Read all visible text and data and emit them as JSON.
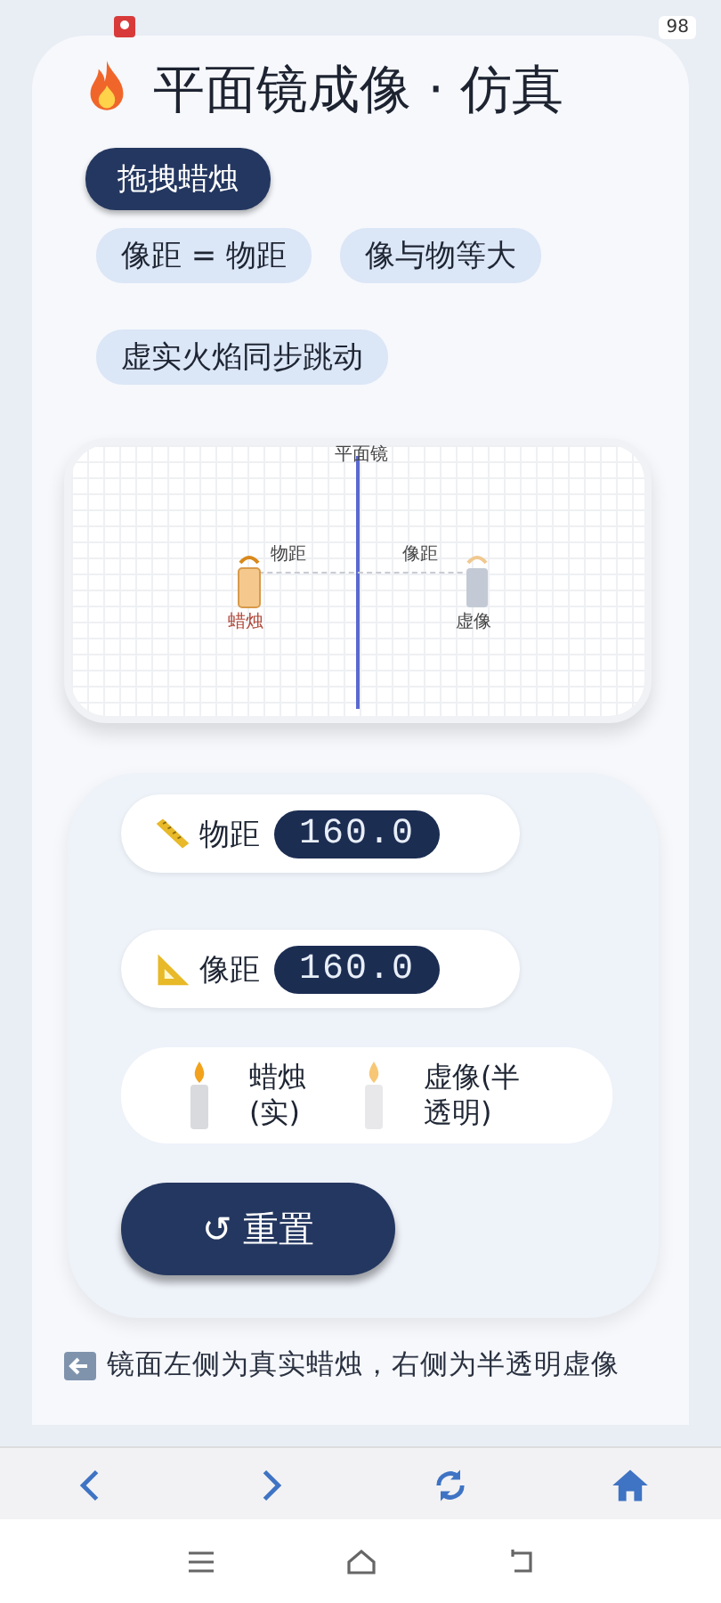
{
  "status_bar": {
    "battery": "98"
  },
  "title": "平面镜成像 · 仿真",
  "drag_button": {
    "label": "拖拽蜡烛"
  },
  "tags": [
    {
      "label": "像距 = 物距"
    },
    {
      "label": "像与物等大"
    },
    {
      "label": "虚实火焰同步跳动"
    }
  ],
  "diagram": {
    "mirror_label": "平面镜",
    "object_distance_label": "物距",
    "image_distance_label": "像距",
    "candle_label": "蜡烛",
    "image_label": "虚像"
  },
  "readouts": [
    {
      "kind": "ruler",
      "label": "物距",
      "value": "160.0"
    },
    {
      "kind": "triangle",
      "label": "像距",
      "value": "160.0"
    }
  ],
  "legend": [
    {
      "kind": "real",
      "label": "蜡烛(实)"
    },
    {
      "kind": "virtual",
      "label": "虚像(半透明)"
    }
  ],
  "reset_button": {
    "label": "↺ 重置"
  },
  "note": "镜面左侧为真实蜡烛，右侧为半透明虚像"
}
